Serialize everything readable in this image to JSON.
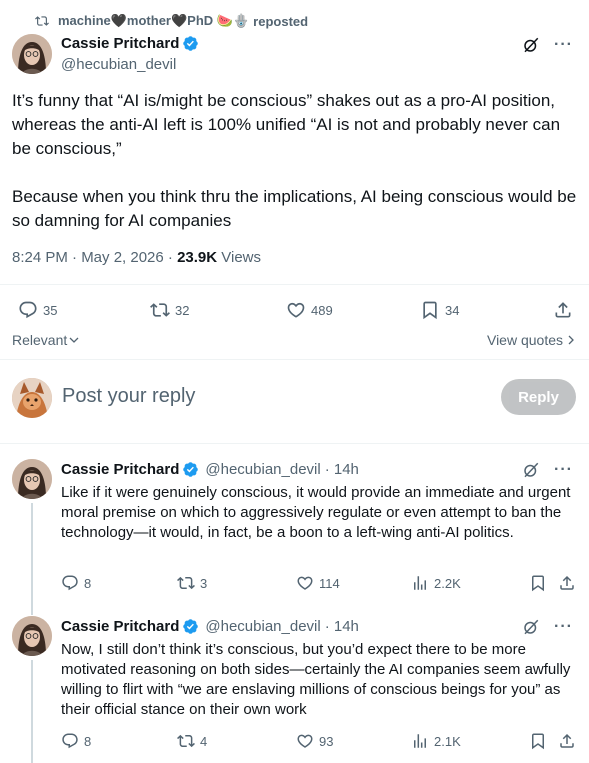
{
  "repost": {
    "user": "machine🖤mother🖤PhD 🍉🪬",
    "label": "reposted"
  },
  "main_tweet": {
    "author_name": "Cassie Pritchard",
    "author_handle": "@hecubian_devil",
    "text": "It’s funny that “AI is/might be conscious” shakes out as a pro-AI position, whereas the anti-AI left is 100% unified “AI is not and probably never can be conscious,”\n\nBecause when you think thru the implications, AI being conscious would be so damning for AI companies",
    "time": "8:24 PM · May 2, 2026 · ",
    "views_count": "23.9K",
    "views_label": " Views",
    "replies": "35",
    "reposts": "32",
    "likes": "489",
    "bookmarks": "34"
  },
  "sort": {
    "label": "Relevant"
  },
  "view_quotes": {
    "label": "View quotes"
  },
  "composer": {
    "placeholder": "Post your reply",
    "reply_button": "Reply"
  },
  "replies": [
    {
      "author_name": "Cassie Pritchard",
      "author_handle": "@hecubian_devil",
      "time": "· 14h",
      "text": "Like if it were genuinely conscious, it would provide an immediate and urgent moral premise on which to aggressively regulate or even attempt to ban the technology—it would, in fact, be a boon to a left-wing anti-AI politics.",
      "replies": "8",
      "reposts": "3",
      "likes": "114",
      "views": "2.2K"
    },
    {
      "author_name": "Cassie Pritchard",
      "author_handle": "@hecubian_devil",
      "time": "· 14h",
      "text": "Now, I still don’t think it’s conscious, but you’d expect there to be more motivated reasoning on both sides—certainly the AI companies seem awfully willing to flirt with “we are enslaving millions of conscious beings for you” as their official stance on their own work",
      "replies": "8",
      "reposts": "4",
      "likes": "93",
      "views": "2.1K"
    }
  ],
  "colors": {
    "text": "#0f1419",
    "muted": "#536471",
    "verified": "#1d9bf0",
    "divider": "#eff3f4",
    "reply_button": "#8f9396"
  },
  "icons": {
    "repost": "repost-icon",
    "verified": "verified-badge-icon",
    "grok": "grok-icon",
    "more": "more-icon",
    "reply": "reply-icon",
    "like": "heart-icon",
    "bookmark": "bookmark-icon",
    "share": "share-icon",
    "views": "views-icon"
  }
}
